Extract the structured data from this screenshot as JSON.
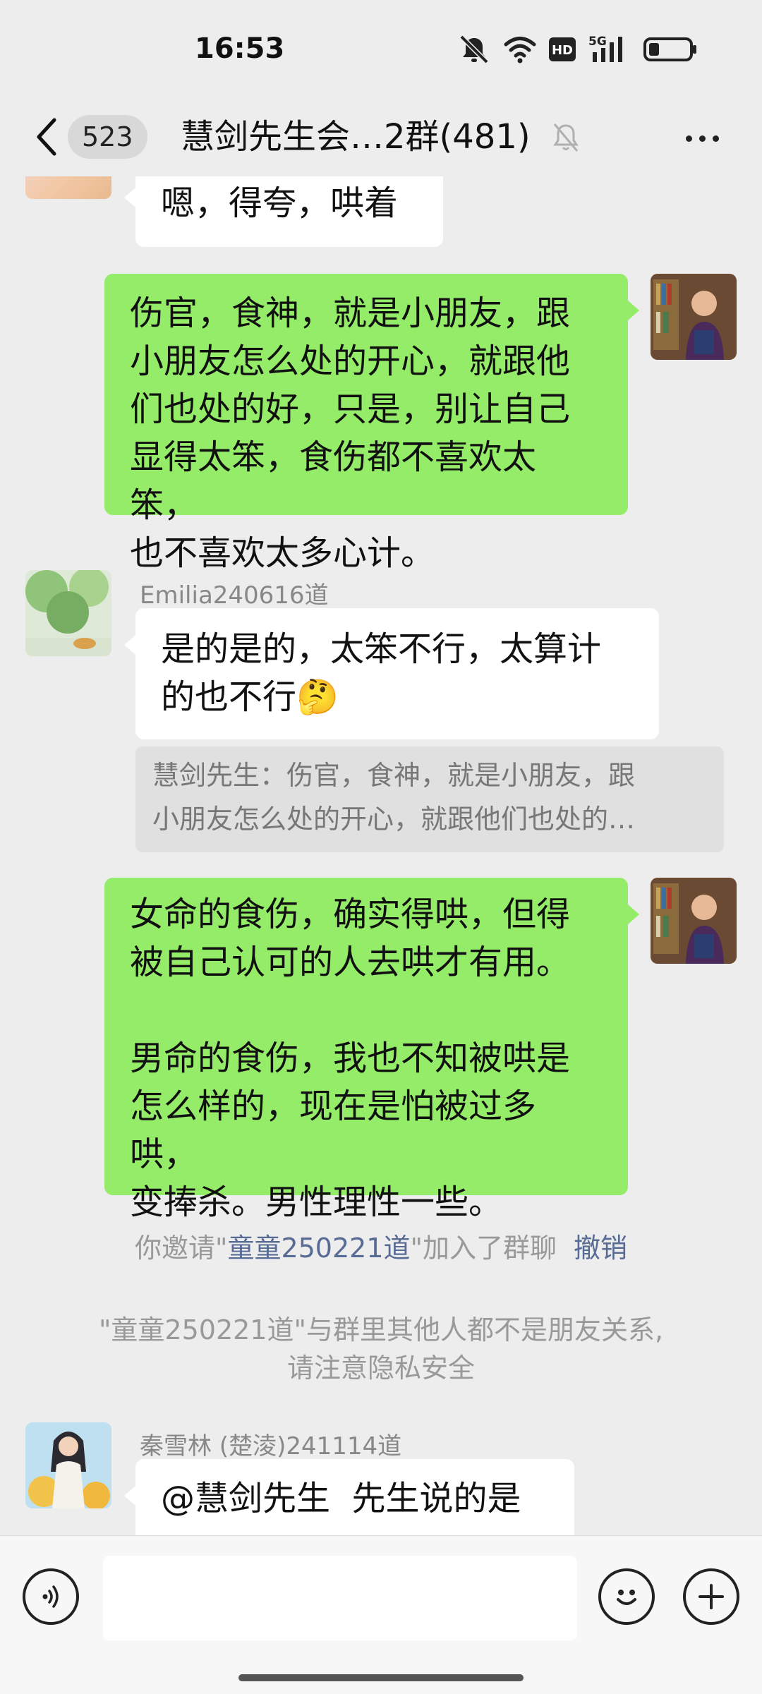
{
  "status_bar": {
    "time": "16:53",
    "icons": [
      "mute-icon",
      "wifi-icon",
      "hd-icon",
      "5g-signal-icon",
      "battery-icon"
    ],
    "hd_label": "HD",
    "network_label": "5G"
  },
  "header": {
    "unread_count": "523",
    "title": "慧剑先生会…2群(481)",
    "muted": true
  },
  "messages": [
    {
      "side": "left",
      "text": "嗯，得夸，哄着"
    },
    {
      "side": "right",
      "text": "伤官，食神，就是小朋友，跟\n小朋友怎么处的开心，就跟他\n们也处的好，只是，别让自己\n显得太笨，食伤都不喜欢太笨，\n也不喜欢太多心计。"
    },
    {
      "side": "left",
      "sender": "Emilia240616道",
      "text": "是的是的，太笨不行，太算计\n的也不行🤔",
      "quote_lines": [
        "慧剑先生：伤官，食神，就是小朋友，跟",
        "小朋友怎么处的开心，就跟他们也处的…"
      ]
    },
    {
      "side": "right",
      "text": "女命的食伤，确实得哄，但得\n被自己认可的人去哄才有用。\n\n男命的食伤，我也不知被哄是\n怎么样的，现在是怕被过多哄，\n变捧杀。男性理性一些。"
    },
    {
      "side": "left",
      "sender": "秦雪林 (楚淩)241114道",
      "text": "@慧剑先生  先生说的是"
    }
  ],
  "system": {
    "invite_prefix": "你邀请\"",
    "invite_name": "童童250221道",
    "invite_suffix": "\"加入了群聊",
    "revoke": "撤销",
    "privacy_line1": "\"童童250221道\"与群里其他人都不是朋友关系,",
    "privacy_line2": "请注意隐私安全"
  },
  "input_bar": {
    "placeholder": ""
  },
  "colors": {
    "background": "#ededed",
    "bubble_self": "#95ec69",
    "bubble_other": "#ffffff",
    "link": "#576b95"
  }
}
